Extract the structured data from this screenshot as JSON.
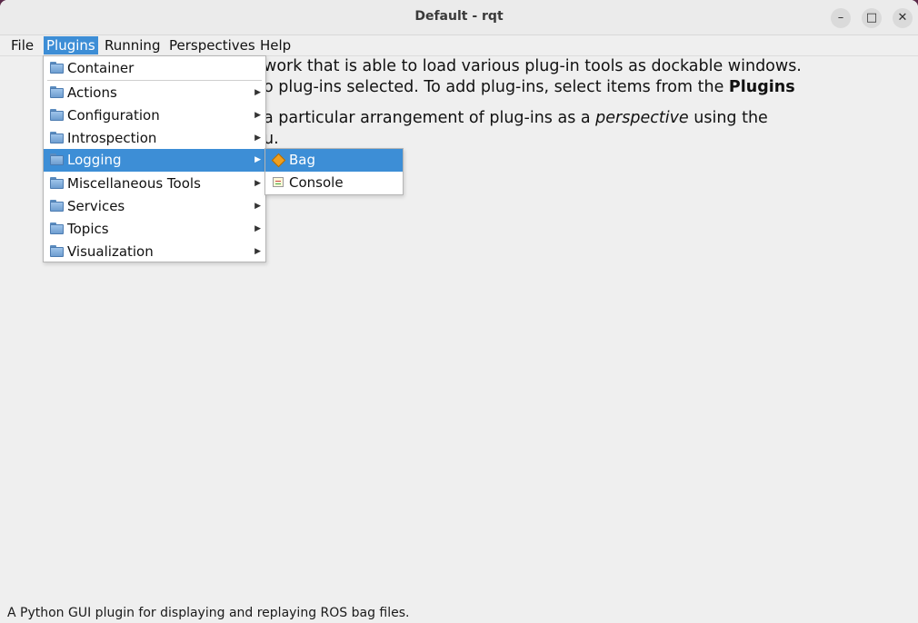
{
  "window": {
    "title": "Default - rqt"
  },
  "window_controls": {
    "minimize": "–",
    "maximize": "□",
    "close": "✕"
  },
  "menubar": {
    "file": "File",
    "plugins": "Plugins",
    "running": "Running",
    "perspectives": "Perspectives",
    "help": "Help"
  },
  "plugins_menu": {
    "items": [
      {
        "label": "Container",
        "submenu": false
      },
      {
        "label": "Actions",
        "submenu": true
      },
      {
        "label": "Configuration",
        "submenu": true
      },
      {
        "label": "Introspection",
        "submenu": true
      },
      {
        "label": "Logging",
        "submenu": true,
        "highlighted": true
      },
      {
        "label": "Miscellaneous Tools",
        "submenu": true
      },
      {
        "label": "Services",
        "submenu": true
      },
      {
        "label": "Topics",
        "submenu": true
      },
      {
        "label": "Visualization",
        "submenu": true
      }
    ]
  },
  "logging_submenu": {
    "items": [
      {
        "label": "Bag",
        "icon": "bag-icon",
        "highlighted": true
      },
      {
        "label": "Console",
        "icon": "console-icon"
      }
    ]
  },
  "description": {
    "line1": "work that is able to load various plug-in tools as dockable windows.",
    "line2_a": "y no plug-ins selected. To add plug-ins, select items from the ",
    "line2_b": "Plugins",
    "line4_a": "a particular arrangement of plug-ins as a ",
    "line4_b": "perspective",
    "line4_c": " using the",
    "line5": "u."
  },
  "statusbar": {
    "text": "A Python GUI plugin for displaying and replaying ROS bag files."
  },
  "colors": {
    "highlight": "#3d8ed6",
    "background": "#efefef"
  }
}
